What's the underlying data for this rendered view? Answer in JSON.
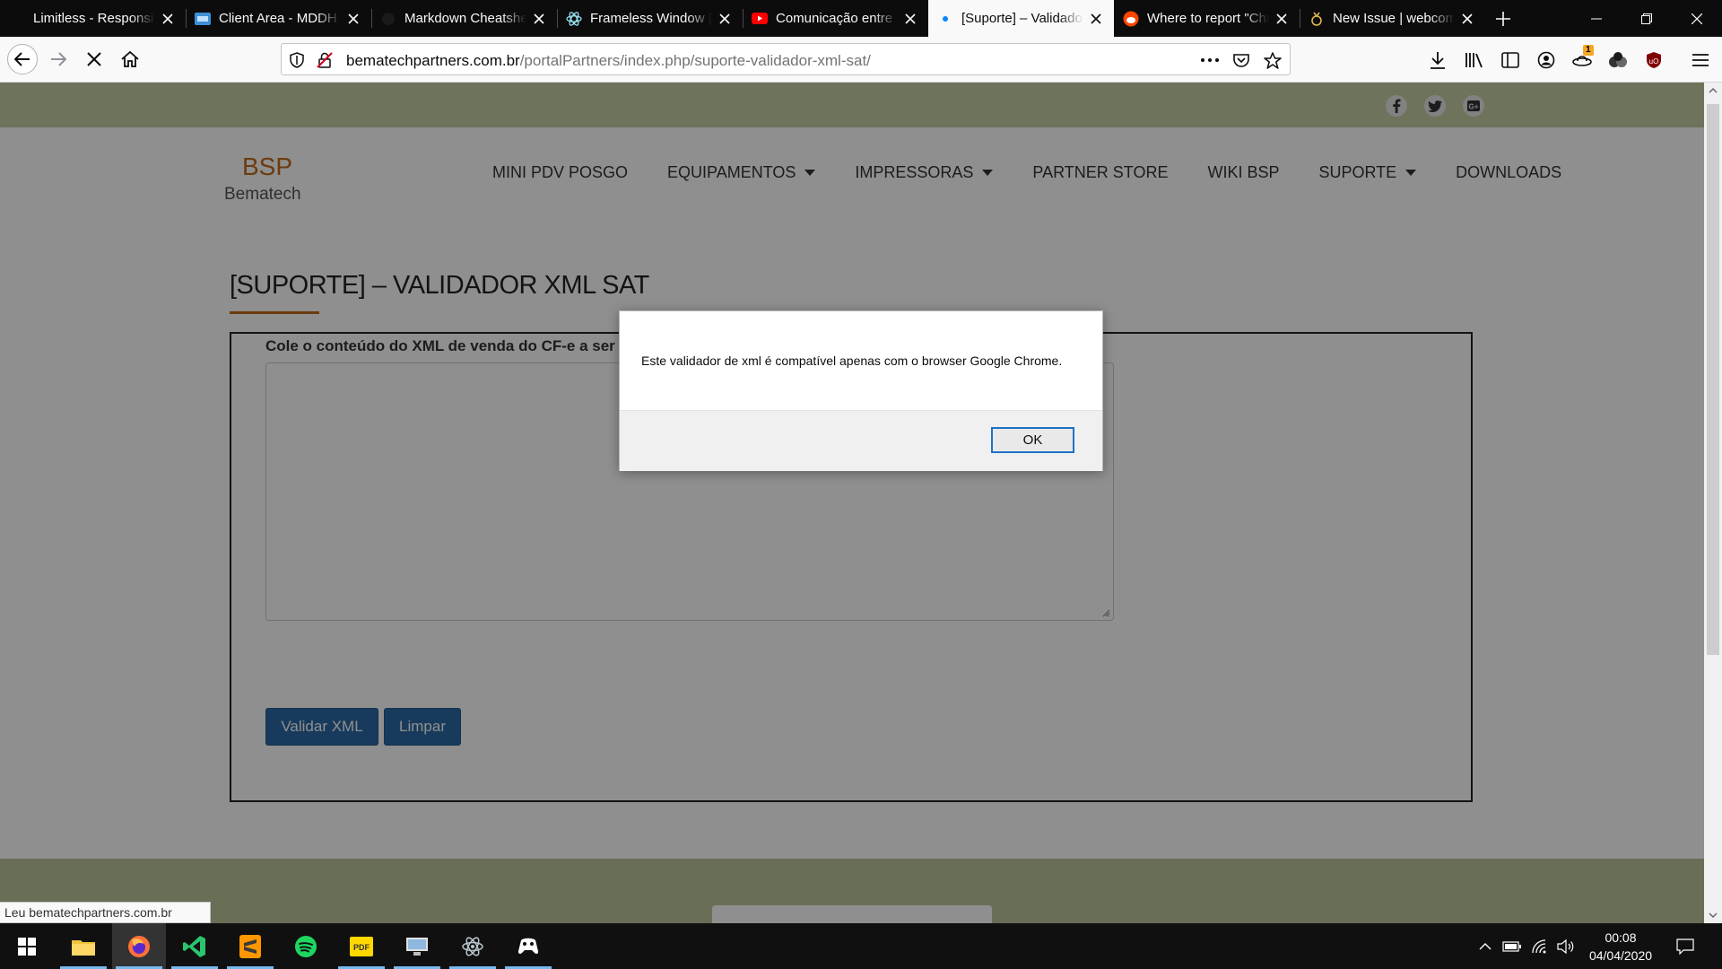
{
  "browser": {
    "tabs": [
      {
        "title": "Limitless - Responsive W",
        "icon": "generic-page-icon"
      },
      {
        "title": "Client Area - MDDH",
        "icon": "client-area-icon"
      },
      {
        "title": "Markdown Cheatsheet",
        "icon": "github-icon"
      },
      {
        "title": "Frameless Window | Electron",
        "icon": "electron-icon"
      },
      {
        "title": "Comunicação entre",
        "icon": "youtube-icon"
      },
      {
        "title": "[Suporte] – Validador",
        "icon": "loading-dot-icon",
        "active": true
      },
      {
        "title": "Where to report \"Chrome",
        "icon": "reddit-icon"
      },
      {
        "title": "New Issue | webcompat",
        "icon": "webcompat-icon"
      }
    ],
    "url_host": "bematechpartners.com.br",
    "url_path": "/portalPartners/index.php/suporte-validador-xml-sat/",
    "status_text": "Leu bematechpartners.com.br",
    "badge_count": "1"
  },
  "site": {
    "logo_title": "BSP",
    "logo_subtitle": "Bematech",
    "menu": [
      {
        "label": "MINI PDV POSGO",
        "dropdown": false
      },
      {
        "label": "EQUIPAMENTOS",
        "dropdown": true
      },
      {
        "label": "IMPRESSORAS",
        "dropdown": true
      },
      {
        "label": "PARTNER STORE",
        "dropdown": false
      },
      {
        "label": "WIKI BSP",
        "dropdown": false
      },
      {
        "label": "SUPORTE",
        "dropdown": true
      },
      {
        "label": "DOWNLOADS",
        "dropdown": false
      }
    ],
    "social": [
      "facebook-icon",
      "twitter-icon",
      "google-plus-icon"
    ],
    "page_title": "[SUPORTE] – VALIDADOR XML SAT",
    "form_label": "Cole o conteúdo do XML de venda do CF-e a ser validado:",
    "validate_button": "Validar XML",
    "clear_button": "Limpar",
    "accent_color": "#c06a1c",
    "button_color": "#2b6aa6"
  },
  "dialog": {
    "message": "Este validador de xml é compatível apenas com o browser Google Chrome.",
    "ok_label": "OK"
  },
  "taskbar": {
    "time": "00:08",
    "date": "04/04/2020",
    "apps": [
      "windows-start-icon",
      "file-explorer-icon",
      "firefox-icon",
      "visual-studio-icon",
      "sublime-text-icon",
      "spotify-icon",
      "pdf-reader-icon",
      "remote-desktop-icon",
      "electron-icon",
      "game-controller-icon"
    ]
  }
}
